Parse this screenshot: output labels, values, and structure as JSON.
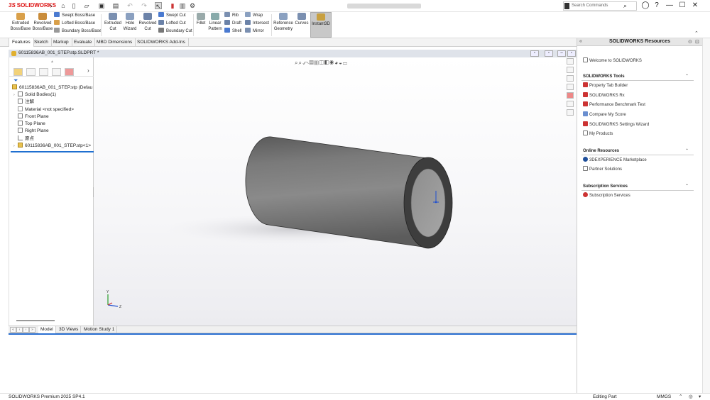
{
  "app": {
    "logo_ds": "3S",
    "logo_text": "SOLIDWORKS"
  },
  "search": {
    "placeholder": "Search Commands"
  },
  "window_controls": {
    "help": "?",
    "minimize": "—",
    "maximize": "☐",
    "close": "✕"
  },
  "ribbon": {
    "extruded_boss": "Extruded\nBoss/Base",
    "revolved_boss": "Revolved\nBoss/Base",
    "swept_boss": "Swept Boss/Base",
    "lofted_boss": "Lofted Boss/Base",
    "boundary_boss": "Boundary Boss/Base",
    "extruded_cut": "Extruded\nCut",
    "hole_wizard": "Hole\nWizard",
    "revolved_cut": "Revolved\nCut",
    "swept_cut": "Swept Cut",
    "lofted_cut": "Lofted Cut",
    "boundary_cut": "Boundary Cut",
    "fillet": "Fillet",
    "linear_pattern": "Linear\nPattern",
    "rib": "Rib",
    "draft": "Draft",
    "shell": "Shell",
    "wrap": "Wrap",
    "intersect": "Intersect",
    "mirror": "Mirror",
    "reference_geometry": "Reference\nGeometry",
    "curves": "Curves",
    "instant3d": "Instant3D"
  },
  "tabs": [
    "Features",
    "Sketch",
    "Markup",
    "Evaluate",
    "MBD Dimensions",
    "SOLIDWORKS Add-Ins"
  ],
  "document": {
    "title": "60115836AB_001_STEP.stp.SLDPRT *"
  },
  "tree": {
    "root": "60115836AB_001_STEP.stp (Defau",
    "items": [
      {
        "label": "Solid Bodies(1)",
        "expand": "›"
      },
      {
        "label": "注解",
        "expand": ""
      },
      {
        "label": "Material <not specified>",
        "expand": ""
      },
      {
        "label": "Front Plane",
        "expand": ""
      },
      {
        "label": "Top Plane",
        "expand": ""
      },
      {
        "label": "Right Plane",
        "expand": ""
      },
      {
        "label": "原点",
        "expand": ""
      },
      {
        "label": "60115836AB_001_STEP.stp<1>",
        "expand": "›"
      }
    ]
  },
  "bottom_tabs": [
    "Model",
    "3D Views",
    "Motion Study 1"
  ],
  "status": {
    "product": "SOLIDWORKS Premium 2025 SP4.1",
    "mode": "Editing Part",
    "units": "MMGS"
  },
  "resources": {
    "header": "SOLIDWORKS Resources",
    "welcome": "Welcome to SOLIDWORKS",
    "tools_title": "SOLIDWORKS Tools",
    "tools": [
      "Property Tab Builder",
      "SOLIDWORKS Rx",
      "Performance Benchmark Test",
      "Compare My Score",
      "SOLIDWORKS Settings Wizard",
      "My Products"
    ],
    "online_title": "Online Resources",
    "online": [
      "3DEXPERIENCE Marketplace",
      "Partner Solutions"
    ],
    "subs_title": "Subscription Services",
    "subs": [
      "Subscription Services"
    ]
  },
  "colors": {
    "accent_blue": "#1f6fd0",
    "brand_red": "#d11111",
    "model_grey": "#6f6f6f"
  }
}
